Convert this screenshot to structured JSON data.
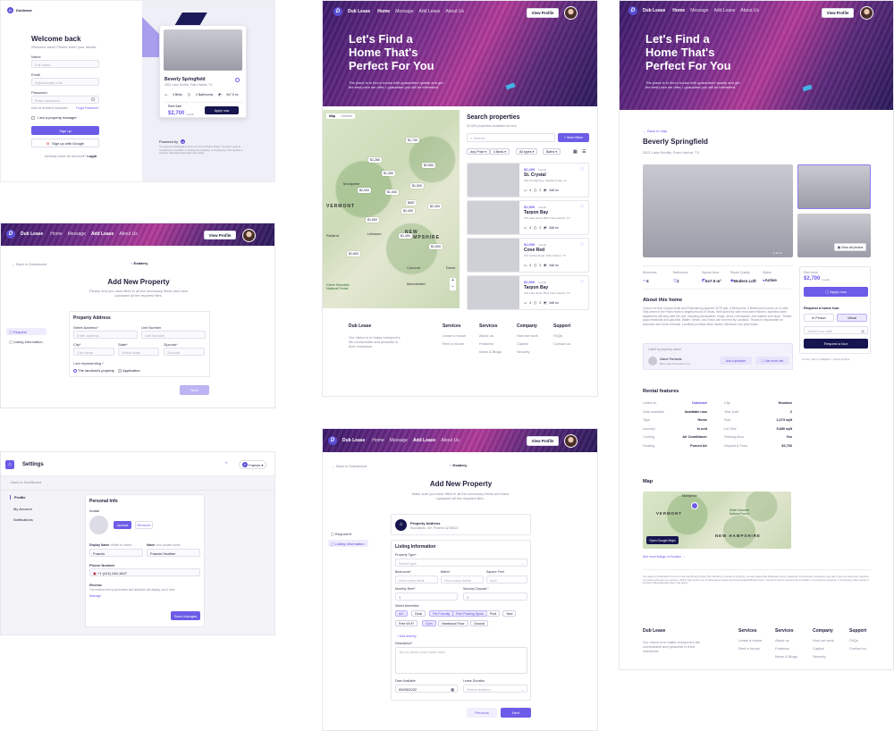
{
  "login": {
    "brand": "Dubleasé",
    "title": "Welcome back",
    "subtitle": "Welcome back! Please enter your details.",
    "name_label": "Name",
    "name_ph": "Full name",
    "email_label": "Email",
    "email_ph": "hi@example.com",
    "password_label": "Password",
    "password_ph": "Enter password",
    "pw_hint": "Must be at least 8 characters",
    "forgot": "Forgot Password?",
    "manager": "I am a property manager",
    "signup": "Sign up",
    "google": "Sign up with Google",
    "have_account": "Already have an account?",
    "login_link": "Login",
    "card_title": "Beverly Springfield",
    "card_addr": "2821 Lake Sevilla, Palm Harbor, TX",
    "card_beds": "4 Beds",
    "card_baths": "2 Bathrooms",
    "card_area": "6x7.5 m²",
    "rent_label": "Rent Sale",
    "price": "$2,700",
    "price_unit": "/month",
    "apply": "Apply now",
    "powered": "Powered by",
    "legal": "You agree to Dubleasé's Terms of Use & Privacy Policy. You don't need to consent as a condition of renting any property, or buying any other goods or services. Message/data rates may apply."
  },
  "nav": {
    "brand": "Dub Lease",
    "home": "Home",
    "message": "Message",
    "add": "Add Lease",
    "about": "About Us",
    "profile": "View Profile"
  },
  "hero": {
    "title1": "Let's Find a",
    "title2": "Home That's",
    "title3": "Perfect For You",
    "desc": "The place is to find a house with guaranteed quality and get the best price we offer, I guarantee you will be interested."
  },
  "search": {
    "tab_map": "Map",
    "tab_satellite": "Satellite",
    "title": "Search properties",
    "count": "32,525 properties available for rent",
    "placeholder": "Search...",
    "more": "More filters",
    "f1": "Any Price",
    "f2": "4 Beds",
    "f3": "All types",
    "f4": "Baths",
    "city_vt": "VERMONT",
    "city_nh": "NEW HAMPSHIRE",
    "city_montpelier": "Montpelier",
    "city_lebanon": "Lebanon",
    "city_concord": "Concord",
    "city_manchester": "Manchester",
    "city_rutland": "Rutland",
    "city_dover": "Dover",
    "forest": "Green Mountain National Forest",
    "listings": [
      {
        "price": "$2,400",
        "unit": "/month",
        "name": "St. Crystal",
        "addr": "210 US Highway, Highland Lake, FL"
      },
      {
        "price": "$1,500",
        "unit": "/month",
        "name": "Tarpon Bay",
        "addr": "103 Lake Shore Blvd, Palm Harbor, TX"
      },
      {
        "price": "$1,600",
        "unit": "/month",
        "name": "Cove Red",
        "addr": "243 Curlew Road, Palm Harbor, TX"
      },
      {
        "price": "$1,500",
        "unit": "/month",
        "name": "Tarpon Bay",
        "addr": "103 Lake Shore Blvd, Palm Harbor, TX"
      }
    ],
    "feat_beds": "4",
    "feat_baths": "2",
    "feat_area": "6x8 m²",
    "pins": [
      "$1,730",
      "$1,280",
      "$2,550",
      "$1,350",
      "$2,500",
      "$1,500",
      "$1,400",
      "$967",
      "$2,400",
      "$1,600",
      "$1,400",
      "$1,600",
      "$1,500",
      "$2,300"
    ]
  },
  "footer": {
    "brand": "Dub Lease",
    "desc": "Our vision is to make everyone's life comfortable and peaceful in their residence.",
    "col1_h": "Services",
    "col1": [
      "Lease a house",
      "Rent a house"
    ],
    "col2_h": "Services",
    "col2": [
      "About us",
      "Features",
      "News & Blogs"
    ],
    "col3_h": "Company",
    "col3": [
      "How we work",
      "Capital",
      "Security"
    ],
    "col4_h": "Support",
    "col4": [
      "FAQs",
      "Contact us"
    ]
  },
  "add1": {
    "back": "Back to Dashboard",
    "logo": "Estatery",
    "title": "Add New Property",
    "subtitle": "Please and you have filled in all the necessary fields and have uploaded all the required files.",
    "side_req": "Request",
    "side_listing": "Listing Information",
    "section": "Property Address",
    "street": "Street Address*",
    "street_ph": "Enter address",
    "unit": "Unit Number",
    "unit_ph": "Unit Number",
    "city": "City*",
    "city_ph": "City name",
    "state": "State*",
    "state_ph": "Select state",
    "zip": "Zipcode*",
    "zip_ph": "Zipcode",
    "rep": "I am representing *",
    "opt1": "The landlord's property",
    "opt2": "Applicaiton",
    "next": "Next"
  },
  "add2": {
    "back": "Back to Dashboard",
    "logo": "Estatery",
    "title": "Add New Property",
    "subtitle": "Make sure you have filled in all the necessary fields and have uploaded all the required files.",
    "side_req": "Request",
    "side_listing": "Listing Information",
    "addr_title": "Property Address",
    "addr_val": "Woodlands, OH, Phoenix AZ 85022",
    "section": "Listing Information",
    "ptype": "Property Type*",
    "ptype_ph": "Select type",
    "bedrooms": "Bedrooms*",
    "bed_ph": "How many beds",
    "baths": "Baths*",
    "bath_ph": "How many baths",
    "sqft": "Square Feet",
    "sqft_ph": "sq ft",
    "rent": "Monthly Rent*",
    "rent_ph": "$",
    "deposit": "Security Deposit *",
    "deposit_ph": "$",
    "amen_label": "Select Amenities",
    "amen": [
      "A/C",
      "Deck",
      "Pet Friendly",
      "Free Parking Spots",
      "Pool",
      "Yard",
      "Free Wi-Fi",
      "Gym",
      "Hardwood Floor",
      "Ground"
    ],
    "add_amen": "Add amenity",
    "desc_label": "Description*",
    "desc_ph": "Tell us about your home here",
    "date_label": "Date Available",
    "date_val": "05/05/2022",
    "lease_label": "Lease Duration",
    "lease_ph": "Select duration",
    "prev": "Previous",
    "next": "Next"
  },
  "settings": {
    "title": "Settings",
    "user": "Francis",
    "back": "Back to Dashboard",
    "side": [
      "Profile",
      "My Account",
      "Notifications"
    ],
    "section": "Personal Info",
    "avatar": "Avatar",
    "upload": "Upload",
    "remove": "Remove",
    "display": "Display Name",
    "display_hint": "Visible to others",
    "display_val": "Francis",
    "name": "Name",
    "name_hint": "Your private name",
    "name_val": "Francis Heather",
    "phone": "Phone Number",
    "phone_val": "+1 (414) 246-1847",
    "review": "Review",
    "review_text": "The reviews from your tenants and landlords will display, see it here.",
    "manage": "Manage",
    "save": "Save changes"
  },
  "detail": {
    "back": "Back to map",
    "title": "Beverly Springfield",
    "addr": "2821 Lake Sevilla, Palm Harbor, TX",
    "view_photos": "View all photos",
    "stats": [
      {
        "k": "Bedrooms",
        "v": "4"
      },
      {
        "k": "Bathrooms",
        "v": "2"
      },
      {
        "k": "Square Area",
        "v": "6x7.5 m²"
      },
      {
        "k": "Repair Quality",
        "v": "Modern Loft"
      },
      {
        "k": "Status",
        "v": "Active"
      }
    ],
    "rent": "Rent price",
    "price": "$2,700",
    "unit": "/month",
    "apply": "Apply now",
    "tour": "Request a home tour",
    "inperson": "In Person",
    "virtual": "Virtual",
    "date": "Select tour date",
    "req_tour": "Request a tour",
    "free": "It's free, with no obligation - cancel anytime",
    "about_title": "About this home",
    "about": "Check out that Custom Built and Entertaining spaces! 3275 sqft, 4 Bedrooms, 3 Bathrooms house on a Lake Villa street in the Palm Harbor neighborhood of Texas. Well-sized for with renovated Kitchen, stainless steel appliances will stay with the unit, including dishwasher, fridge, stove, microwave, and washer and dryer. Tenant pays electricity and gas bills. Water, Sewer, and Trash are covered by Landlord. Tenant is responsible for lawncare and snow removal. Landlord provides lawn mower, Minimum one year lease.",
    "owner_label": "Listed by property owner",
    "owner": "Diane Richards",
    "owner_co": "Blue Lake Properties LLC",
    "ask": "Ask a question",
    "info": "Get more info",
    "features_title": "Rental features",
    "f_left": [
      [
        "Listed on",
        "Dubleasé"
      ],
      [
        "Date available",
        "Available now"
      ],
      [
        "Type",
        "Home"
      ],
      [
        "Laundry",
        "In unit"
      ],
      [
        "Cooling",
        "Air Conditioner"
      ],
      [
        "Heating",
        "Forced Air"
      ]
    ],
    "f_right": [
      [
        "City",
        "Houston"
      ],
      [
        "Year built",
        "2"
      ],
      [
        "Size",
        "2,273 sqft"
      ],
      [
        "Lot Size",
        "9,680 sqft"
      ],
      [
        "Parking Area",
        "Yes"
      ],
      [
        "Deposit & Fees",
        "$2,700"
      ]
    ],
    "map_title": "Map",
    "open_map": "Open Google Maps",
    "more_map": "See more listings in Houston",
    "legal": "You agree to Dubleasé's Terms of Use and Privacy Policy. By choosing to contact a property, you also agree that Dubleasé Group, landlords, and property managers may call or text you about any inquiries you submit through our services, which may involve use of automated means and prerecorded/artificial voices. You don't need to consent as a condition of renting any property, or buying any other goods or services. Message/data rates may apply.",
    "map_vt": "VERMONT",
    "map_nh": "NEW HAMPSHIRE",
    "map_montpelier": "Montpelier",
    "map_forest": "White Mountain National Forest"
  }
}
